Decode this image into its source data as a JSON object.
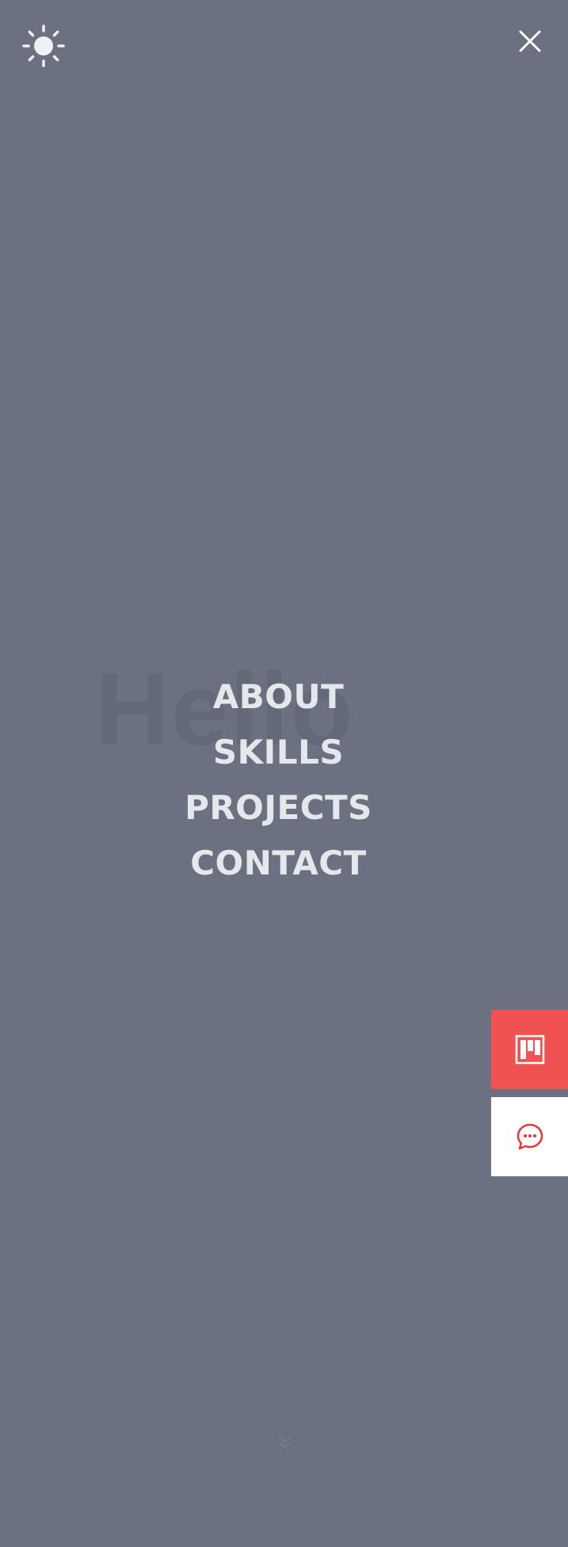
{
  "hero": {
    "ghost_text": "Hello"
  },
  "header": {
    "theme_toggle_icon": "sun-icon",
    "close_icon": "close-icon"
  },
  "nav": {
    "items": [
      {
        "label": "ABOUT"
      },
      {
        "label": "SKILLS"
      },
      {
        "label": "PROJECTS"
      },
      {
        "label": "CONTACT"
      }
    ]
  },
  "side_actions": {
    "kanban_icon": "kanban-icon",
    "chat_icon": "chat-bubble-icon"
  },
  "colors": {
    "overlay_bg": "#6b7180",
    "nav_text": "#e6e7ea",
    "accent_red": "#f05252",
    "white": "#ffffff"
  },
  "scroll_hint_icon": "chevron-down-icon"
}
